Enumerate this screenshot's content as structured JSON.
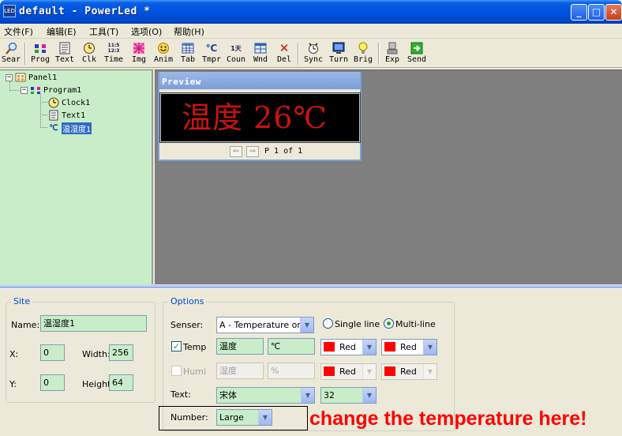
{
  "window": {
    "title": "default - PowerLed *",
    "app_icon_text": "LED",
    "minimize": "_",
    "maximize": "□",
    "close": "✕"
  },
  "menu": [
    "文件(F)",
    "编辑(E)",
    "工具(T)",
    "选项(O)",
    "帮助(H)"
  ],
  "toolbar": [
    {
      "label": "Sear",
      "icon": "search-icon"
    },
    {
      "label": "Prog",
      "icon": "program-icon"
    },
    {
      "label": "Text",
      "icon": "text-icon"
    },
    {
      "label": "Clk",
      "icon": "clock-icon"
    },
    {
      "label": "Time",
      "icon": "time-icon"
    },
    {
      "label": "Img",
      "icon": "image-icon"
    },
    {
      "label": "Anim",
      "icon": "animation-icon"
    },
    {
      "label": "Tab",
      "icon": "table-icon"
    },
    {
      "label": "Tmpr",
      "icon": "temperature-icon"
    },
    {
      "label": "Coun",
      "icon": "counter-icon"
    },
    {
      "label": "Wnd",
      "icon": "window-icon"
    },
    {
      "label": "Del",
      "icon": "delete-icon"
    },
    {
      "label": "Sync",
      "icon": "sync-icon"
    },
    {
      "label": "Turn",
      "icon": "turn-icon"
    },
    {
      "label": "Brig",
      "icon": "brightness-icon"
    },
    {
      "label": "Exp",
      "icon": "export-icon"
    },
    {
      "label": "Send",
      "icon": "send-icon"
    }
  ],
  "toolbar_glyphs": {
    "time": "11:5 12:3",
    "counter": "1天",
    "temperature": "℃",
    "delete": "✕"
  },
  "tree": {
    "panel": "Panel1",
    "program": "Program1",
    "clock": "Clock1",
    "text": "Text1",
    "temp": "温湿度1",
    "temp_glyph": "℃"
  },
  "preview": {
    "title": "Preview",
    "display_text": "温度  26℃",
    "prev_arrow": "⇐",
    "next_arrow": "⇒",
    "page_text": "P 1 of 1"
  },
  "site": {
    "group_title": "Site",
    "name_label": "Name:",
    "name_value": "温湿度1",
    "x_label": "X:",
    "x_value": "0",
    "width_label": "Width:",
    "width_value": "256",
    "y_label": "Y:",
    "y_value": "0",
    "height_label": "Height",
    "height_value": "64"
  },
  "options": {
    "group_title": "Options",
    "senser_label": "Senser:",
    "senser_value": "A - Temperature only",
    "single_line": "Single line",
    "multi_line": "Multi-line",
    "temp_label": "Temp",
    "temp_text": "温度",
    "temp_unit": "℃",
    "temp_color1": "Red",
    "temp_color2": "Red",
    "humi_label": "Humi",
    "humi_text": "湿度",
    "humi_unit": "%",
    "humi_color1": "Red",
    "humi_color2": "Red",
    "text_label": "Text:",
    "font_value": "宋体",
    "size_value": "32",
    "number_label": "Number:",
    "number_value": "Large"
  },
  "annotation": "change the temperature here!",
  "colors": {
    "led_red": "#cc1111",
    "swatch_red": "#ff0000",
    "tree_bg": "#c8edc8",
    "annotation": "#ff0000"
  }
}
